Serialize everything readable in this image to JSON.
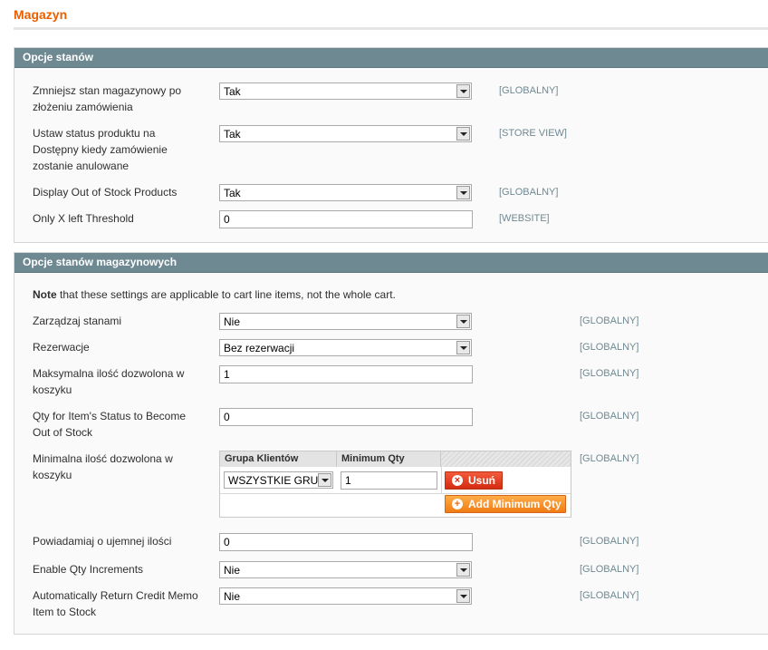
{
  "page": {
    "title": "Magazyn"
  },
  "section1": {
    "title": "Opcje stanów",
    "rows": [
      {
        "label": "Zmniejsz stan magazynowy po złożeniu zamówienia",
        "value": "Tak",
        "scope": "[GLOBALNY]"
      },
      {
        "label": "Ustaw status produktu na Dostępny kiedy zamówienie zostanie anulowane",
        "value": "Tak",
        "scope": "[STORE VIEW]"
      },
      {
        "label": "Display Out of Stock Products",
        "value": "Tak",
        "scope": "[GLOBALNY]"
      },
      {
        "label": "Only X left Threshold",
        "value": "0",
        "scope": "[WEBSITE]"
      }
    ]
  },
  "section2": {
    "title": "Opcje stanów magazynowych",
    "note_bold": "Note",
    "note_rest": " that these settings are applicable to cart line items, not the whole cart.",
    "rows": [
      {
        "label": "Zarządzaj stanami",
        "value": "Nie",
        "scope": "[GLOBALNY]"
      },
      {
        "label": "Rezerwacje",
        "value": "Bez rezerwacji",
        "scope": "[GLOBALNY]"
      },
      {
        "label": "Maksymalna ilość dozwolona w koszyku",
        "value": "1",
        "scope": "[GLOBALNY]"
      },
      {
        "label": "Qty for Item's Status to Become Out of Stock",
        "value": "0",
        "scope": "[GLOBALNY]"
      },
      {
        "label": "Minimalna ilość dozwolona w koszyku",
        "scope": "[GLOBALNY]"
      },
      {
        "label": "Powiadamiaj o ujemnej ilości",
        "value": "0",
        "scope": "[GLOBALNY]"
      },
      {
        "label": "Enable Qty Increments",
        "value": "Nie",
        "scope": "[GLOBALNY]"
      },
      {
        "label": "Automatically Return Credit Memo Item to Stock",
        "value": "Nie",
        "scope": "[GLOBALNY]"
      }
    ],
    "min_qty_grid": {
      "col_group": "Grupa Klientów",
      "col_qty": "Minimum Qty",
      "group_value": "WSZYSTKIE GRU",
      "qty_value": "1",
      "delete_label": "Usuń",
      "add_label": "Add Minimum Qty"
    }
  }
}
